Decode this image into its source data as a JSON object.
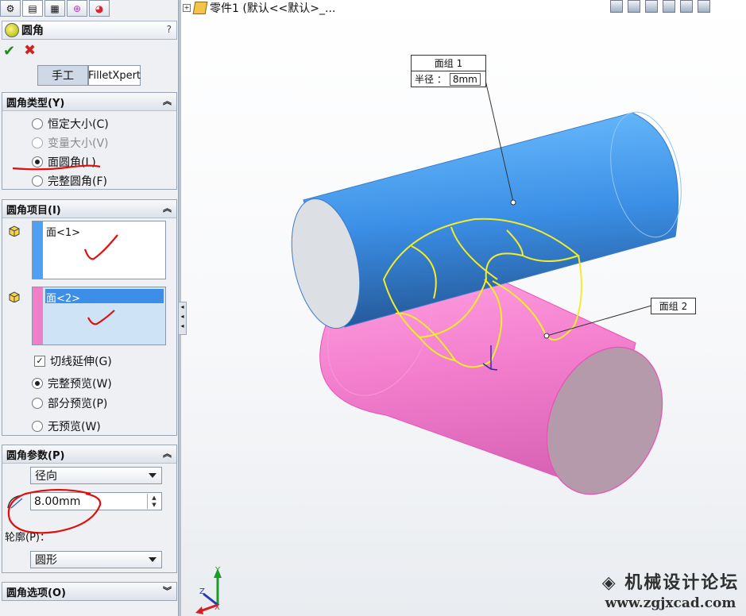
{
  "panel": {
    "title": "圆角",
    "help": "?",
    "mode_manual": "手工",
    "mode_expert": "FilletXpert"
  },
  "fillet_type": {
    "header": "圆角类型(Y)",
    "options": [
      {
        "label": "恒定大小(C)",
        "selected": false,
        "enabled": true
      },
      {
        "label": "变量大小(V)",
        "selected": false,
        "enabled": false
      },
      {
        "label": "面圆角(L)",
        "selected": true,
        "enabled": true
      },
      {
        "label": "完整圆角(F)",
        "selected": false,
        "enabled": true
      }
    ]
  },
  "fillet_items": {
    "header": "圆角项目(I)",
    "face_set_1": "面<1>",
    "face_set_2": "面<2>",
    "tangent_propagation": "切线延伸(G)",
    "preview_full": "完整预览(W)",
    "preview_partial": "部分预览(P)",
    "preview_none": "无预览(W)",
    "color_1": "#4f9ff2",
    "color_2": "#f17fc8"
  },
  "fillet_params": {
    "header": "圆角参数(P)",
    "method": "径向",
    "radius": "8.00mm",
    "profile_label": "轮廓(P)：",
    "profile": "圆形"
  },
  "fillet_options": {
    "header": "圆角选项(O)"
  },
  "viewport": {
    "tree_label": "零件1 (默认<<默认>_...",
    "callout_1_title": "面组 1",
    "callout_1_key": "半径 ：",
    "callout_1_value": "8mm",
    "callout_2_title": "面组 2",
    "axis_y": "Y",
    "axis_z": "Z",
    "axis_x": "X"
  },
  "watermark": {
    "name": "机械设计论坛",
    "url": "www.zgjxcad.com"
  }
}
